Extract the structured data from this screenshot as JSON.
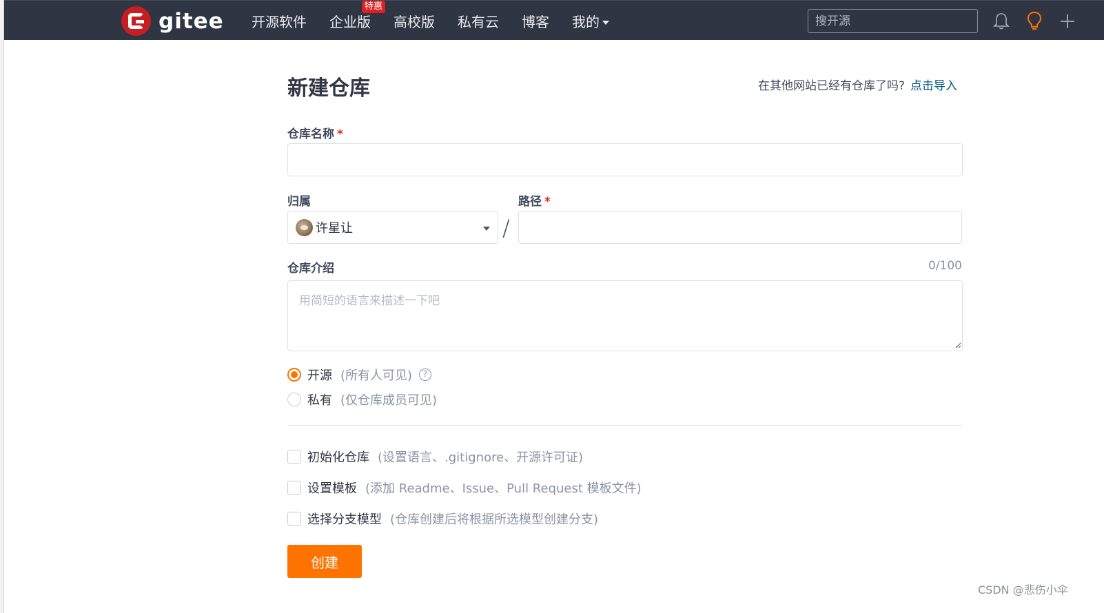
{
  "header": {
    "logo_text": "gitee",
    "nav": [
      {
        "label": "开源软件"
      },
      {
        "label": "企业版",
        "badge": "特惠"
      },
      {
        "label": "高校版"
      },
      {
        "label": "私有云"
      },
      {
        "label": "博客"
      },
      {
        "label": "我的"
      }
    ],
    "search_placeholder": "搜开源",
    "icons": [
      "bell-icon",
      "lightbulb-icon",
      "plus-icon"
    ],
    "background": "#2f3542"
  },
  "form": {
    "title": "新建仓库",
    "import_text": "在其他网站已经有仓库了吗?",
    "import_link": "点击导入",
    "name_label": "仓库名称",
    "name_required": "*",
    "name_value": "",
    "owner_label": "归属",
    "owner_value": "许星让",
    "path_separator": "/",
    "path_label": "路径",
    "path_required": "*",
    "path_value": "",
    "desc_label": "仓库介绍",
    "desc_counter": "0/100",
    "desc_placeholder": "用简短的语言来描述一下吧",
    "visibility": [
      {
        "label": "开源",
        "hint": "(所有人可见)",
        "selected": true,
        "help": "?"
      },
      {
        "label": "私有",
        "hint": "(仅仓库成员可见)",
        "selected": false
      }
    ],
    "options": [
      {
        "label": "初始化仓库",
        "hint": "(设置语言、.gitignore、开源许可证)",
        "checked": false
      },
      {
        "label": "设置模板",
        "hint": "(添加 Readme、Issue、Pull Request 模板文件)",
        "checked": false
      },
      {
        "label": "选择分支模型",
        "hint": "(仓库创建后将根据所选模型创建分支)",
        "checked": false
      }
    ],
    "submit_label": "创建",
    "accent_color": "#fe7300",
    "link_color": "#005980",
    "required_color": "#db2828"
  },
  "watermark": "CSDN @悲伤小伞"
}
